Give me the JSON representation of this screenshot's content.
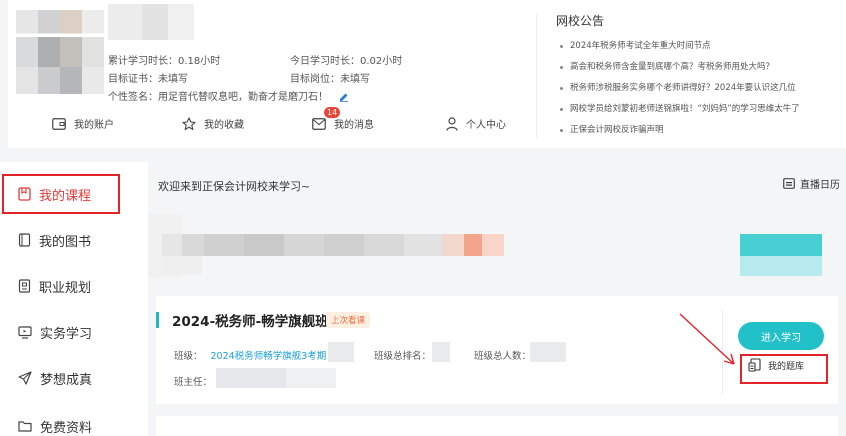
{
  "profile": {
    "study_total_label": "累计学习时长：",
    "study_total_value": "0.18小时",
    "study_today_label": "今日学习时长：",
    "study_today_value": "0.02小时",
    "target_cert_label": "目标证书：",
    "target_cert_value": "未填写",
    "target_job_label": "目标岗位：",
    "target_job_value": "未填写",
    "signature_label": "个性签名：",
    "signature_value": "用足音代替叹息吧，勤奋才是磨刀石！"
  },
  "quick_nav": [
    {
      "label": "我的账户",
      "icon": "wallet-icon"
    },
    {
      "label": "我的收藏",
      "icon": "star-icon"
    },
    {
      "label": "我的消息",
      "icon": "mail-icon",
      "badge": "14"
    },
    {
      "label": "个人中心",
      "icon": "user-icon"
    }
  ],
  "notices": {
    "title": "网校公告",
    "items": [
      "2024年税务师考试全年重大时间节点",
      "高会和税务师含金量到底哪个高？考税务师用处大吗？",
      "税务师涉税服务实务哪个老师讲得好？2024年要认识这几位",
      "网校学员给刘蒙初老师送锦旗啦！“刘妈妈”的学习思维太牛了",
      "正保会计网校反诈骗声明"
    ]
  },
  "sidebar": {
    "items": [
      {
        "label": "我的课程",
        "icon": "course-icon"
      },
      {
        "label": "我的图书",
        "icon": "book-icon"
      },
      {
        "label": "职业规划",
        "icon": "plan-icon"
      },
      {
        "label": "实务学习",
        "icon": "monitor-icon"
      },
      {
        "label": "梦想成真",
        "icon": "paper-plane-icon"
      },
      {
        "label": "免费资料",
        "icon": "folder-icon"
      }
    ]
  },
  "main": {
    "welcome": "欢迎来到正保会计网校来学习~",
    "calendar_label": "直播日历"
  },
  "course": {
    "title": "2024-税务师-畅学旗舰班",
    "tag": "上次看课",
    "class_label": "班级：",
    "class_value": "2024税务师畅学旗舰3考期",
    "rank_label": "班级总排名：",
    "count_label": "班级总人数：",
    "teacher_label": "班主任：",
    "enter_button": "进入学习",
    "question_bank": "我的题库"
  },
  "colors": {
    "accent": "#22c1c9",
    "highlight_red": "#e0242a",
    "active_text": "#e03a3a",
    "link_blue": "#1ea0d8"
  }
}
